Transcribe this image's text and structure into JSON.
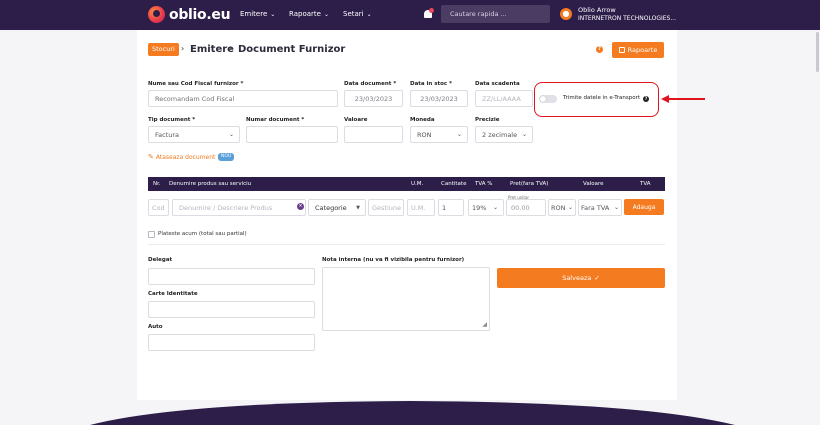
{
  "nav": {
    "logo": "oblio.eu",
    "menu": [
      "Emitere",
      "Rapoarte",
      "Setari"
    ],
    "search_placeholder": "Cautare rapida ...",
    "user_name": "Oblio Arrow",
    "user_company": "INTERNETRON TECHNOLOGIES..."
  },
  "breadcrumb": {
    "badge": "Stocuri",
    "items": [
      "Emitere",
      "Document Furnizor"
    ]
  },
  "header": {
    "rapoarte_label": "Rapoarte"
  },
  "form": {
    "supplier_label": "Nume sau Cod Fiscal furnizor *",
    "supplier_placeholder": "Recomandam Cod Fiscal",
    "doc_date_label": "Data document *",
    "doc_date_value": "23/03/2023",
    "stock_date_label": "Data in stoc *",
    "stock_date_value": "23/03/2023",
    "due_date_label": "Data scadenta",
    "due_date_placeholder": "ZZ/LL/AAAA",
    "etransport_label": "Trimite datele in e-Transport",
    "doc_type_label": "Tip document *",
    "doc_type_value": "Factura",
    "doc_number_label": "Numar document *",
    "value_label": "Valoare",
    "currency_label": "Moneda",
    "currency_value": "RON",
    "precision_label": "Precizie",
    "precision_value": "2 zecimale",
    "attach_label": "Ataseaza document",
    "new_badge": "NOU"
  },
  "table": {
    "headers": [
      "Nr.",
      "Denumire produs sau serviciu",
      "U.M.",
      "Cantitate",
      "TVA %",
      "Pret(fara TVA)",
      "Valoare",
      "TVA"
    ],
    "row": {
      "cod_placeholder": "Cod",
      "name_placeholder": "Denumire / Descriere Produs",
      "category": "Categorie",
      "gestiune_placeholder": "Gestiune",
      "um_placeholder": "U.M.",
      "qty": "1",
      "vat": "19%",
      "price_label": "Pret unitar",
      "price": "00.00",
      "currency": "RON",
      "vat_mode": "Fara TVA",
      "add_label": "Adauga"
    }
  },
  "payment": {
    "label": "Plateste acum (total sau partial)"
  },
  "bottom": {
    "delegate_label": "Delegat",
    "id_card_label": "Carte Identitate",
    "auto_label": "Auto",
    "note_label": "Nota interna (nu va fi vizibila pentru furnizor)",
    "save_label": "Salveaza"
  },
  "colors": {
    "brand": "#2d1d49",
    "accent": "#f47b20",
    "annotation": "#e0141e"
  }
}
